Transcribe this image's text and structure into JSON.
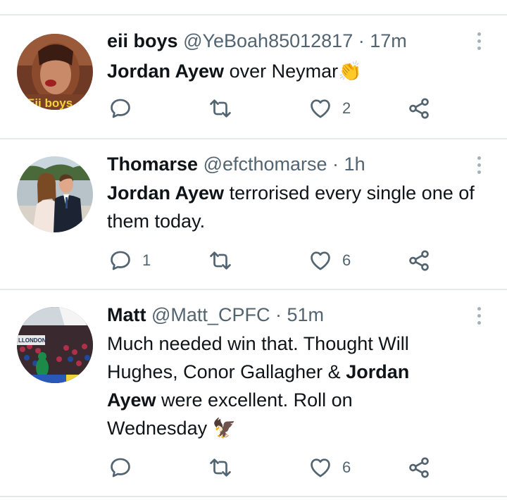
{
  "tweets": [
    {
      "name": "eii boys",
      "handle": "@YeBoah85012817",
      "time": "17m",
      "body_bold": "Jordan Ayew",
      "body_rest": " over Neymar",
      "emoji": "👏",
      "avatar_caption": "Eii boys",
      "reply_count": "",
      "like_count": "2"
    },
    {
      "name": "Thomarse",
      "handle": "@efcthomarse",
      "time": "1h",
      "body_bold": "Jordan Ayew",
      "body_rest": " terrorised every single one of them today.",
      "reply_count": "1",
      "like_count": "6"
    },
    {
      "name": "Matt",
      "handle": "@Matt_CPFC",
      "time": "51m",
      "body_pre": "Much needed win that. Thought Will Hughes, Conor Gallagher & ",
      "body_bold": "Jordan Ayew",
      "body_rest": " were excellent. Roll on Wednesday",
      "emoji": "🦅",
      "avatar_caption": "LLONDON",
      "reply_count": "",
      "like_count": "6"
    }
  ],
  "separator": " · ",
  "icons": [
    "reply-icon",
    "retweet-icon",
    "like-icon",
    "share-icon",
    "more-icon"
  ],
  "colors": {
    "text": "#0f1419",
    "secondary": "#536471",
    "divider": "#e4e8ea",
    "emoji_hands": "#f4b400"
  }
}
